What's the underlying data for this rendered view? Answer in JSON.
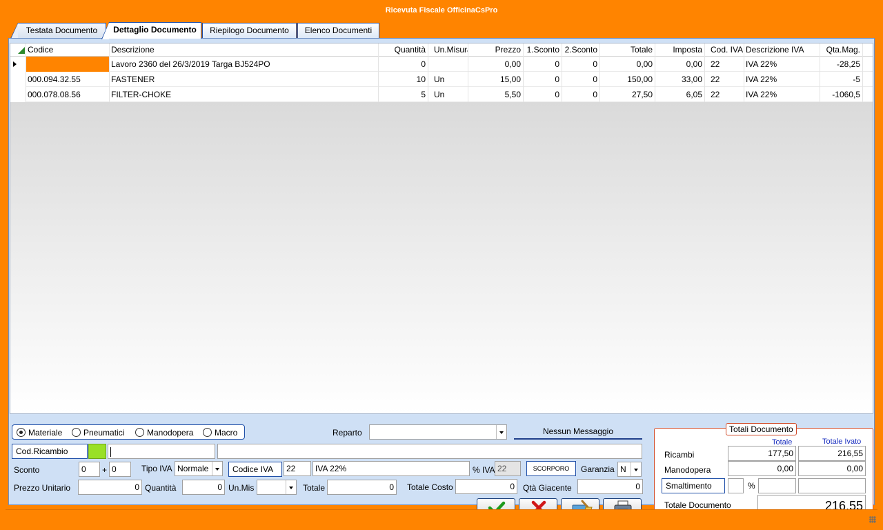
{
  "window": {
    "title": "Ricevuta Fiscale OfficinaCsPro"
  },
  "tabs": [
    {
      "label": "Testata Documento"
    },
    {
      "label": "Dettaglio Documento"
    },
    {
      "label": "Riepilogo Documento"
    },
    {
      "label": "Elenco Documenti"
    }
  ],
  "grid": {
    "columns": [
      "Codice",
      "Descrizione",
      "Quantità",
      "Un.Misura",
      "Prezzo",
      "1.Sconto",
      "2.Sconto",
      "Totale",
      "Imposta",
      "Cod. IVA",
      "Descrizione IVA",
      "Qta.Mag."
    ],
    "rows": [
      {
        "codice": "",
        "descrizione": "Lavoro 2360 del 26/3/2019 Targa BJ524PO",
        "quantita": "0",
        "unmis": "",
        "prezzo": "0,00",
        "sconto1": "0",
        "sconto2": "0",
        "totale": "0,00",
        "imposta": "0,00",
        "codiva": "22",
        "desciva": "IVA 22%",
        "qtamag": "-28,25"
      },
      {
        "codice": "000.094.32.55",
        "descrizione": "FASTENER",
        "quantita": "10",
        "unmis": "Un",
        "prezzo": "15,00",
        "sconto1": "0",
        "sconto2": "0",
        "totale": "150,00",
        "imposta": "33,00",
        "codiva": "22",
        "desciva": "IVA 22%",
        "qtamag": "-5"
      },
      {
        "codice": "000.078.08.56",
        "descrizione": "FILTER-CHOKE",
        "quantita": "5",
        "unmis": "Un",
        "prezzo": "5,50",
        "sconto1": "0",
        "sconto2": "0",
        "totale": "27,50",
        "imposta": "6,05",
        "codiva": "22",
        "desciva": "IVA 22%",
        "qtamag": "-1060,5"
      }
    ]
  },
  "form": {
    "radio": {
      "materiale": "Materiale",
      "pneumatici": "Pneumatici",
      "manodopera": "Manodopera",
      "macro": "Macro"
    },
    "reparto_label": "Reparto",
    "messaggio": "Nessun Messaggio",
    "cod_ricambio_label": "Cod.Ricambio",
    "sconto_label": "Sconto",
    "sconto1": "0",
    "plus": "+",
    "sconto2": "0",
    "tipo_iva_label": "Tipo IVA",
    "tipo_iva_value": "Normale",
    "codice_iva_label": "Codice IVA",
    "codice_iva_value": "22",
    "desc_iva_value": "IVA 22%",
    "perc_iva_label": "% IVA",
    "perc_iva_value": "22",
    "scorporo_label": "SCORPORO",
    "garanzia_label": "Garanzia",
    "garanzia_value": "N",
    "prezzo_unitario_label": "Prezzo Unitario",
    "prezzo_unitario_value": "0",
    "quantita_label": "Quantità",
    "quantita_value": "0",
    "unmis_label": "Un.Mis",
    "totale_label": "Totale",
    "totale_value": "0",
    "totale_costo_label": "Totale Costo",
    "totale_costo_value": "0",
    "qta_giacente_label": "Qtà Giacente",
    "qta_giacente_value": "0"
  },
  "totali": {
    "title": "Totali Documento",
    "col_totale": "Totale",
    "col_totale_ivato": "Totale Ivato",
    "ricambi_label": "Ricambi",
    "ricambi_totale": "177,50",
    "ricambi_ivato": "216,55",
    "manodopera_label": "Manodopera",
    "manodopera_totale": "0,00",
    "manodopera_ivato": "0,00",
    "smaltimento_label": "Smaltimento",
    "perc_sign": "%",
    "totale_documento_label": "Totale Documento",
    "totale_documento_value": "216,55"
  },
  "colors": {
    "accent": "#ff8400",
    "panel": "#cfe0f5",
    "border": "#1f4fa8",
    "selected_cell": "#ff8400",
    "color_swatch": "#99e026"
  }
}
